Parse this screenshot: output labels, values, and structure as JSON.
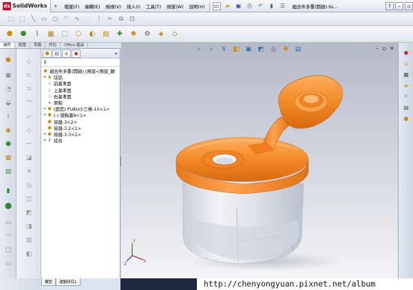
{
  "app": {
    "logo_text": "SolidWorks",
    "title": "組合件多重(開啟).SL..."
  },
  "menu": [
    "檔案(F)",
    "編輯(E)",
    "檢視(V)",
    "插入(I)",
    "工具(T)",
    "視窗(W)",
    "說明(H)"
  ],
  "command_tabs": [
    "組件",
    "配置",
    "草圖",
    "評估",
    "Office 產品"
  ],
  "feature_tree": {
    "root": "組合件多重(開啟) (預設<預設_顯",
    "items": [
      {
        "label": "註記",
        "expand": "+"
      },
      {
        "label": "前基準面",
        "expand": ""
      },
      {
        "label": "上基準面",
        "expand": ""
      },
      {
        "label": "右基準面",
        "expand": ""
      },
      {
        "label": "原點",
        "expand": ""
      },
      {
        "label": "(固定) PUKU小三格-10<1>",
        "expand": "+"
      },
      {
        "label": "(-) 過點蓋9<1>",
        "expand": "+"
      },
      {
        "label": "容器-3<2>",
        "expand": ""
      },
      {
        "label": "容器-3.2<1>",
        "expand": ""
      },
      {
        "label": "容器-3.3<1>",
        "expand": "+"
      },
      {
        "label": "結合",
        "expand": "+"
      }
    ]
  },
  "bottom_tabs": [
    "模型",
    "運動研究1"
  ],
  "watermark": "http://chenyongyuan.pixnet.net/album",
  "colors": {
    "cap": "#f0811e",
    "container": "#dfe3ea",
    "viewport_top": "#b4b9c6"
  }
}
